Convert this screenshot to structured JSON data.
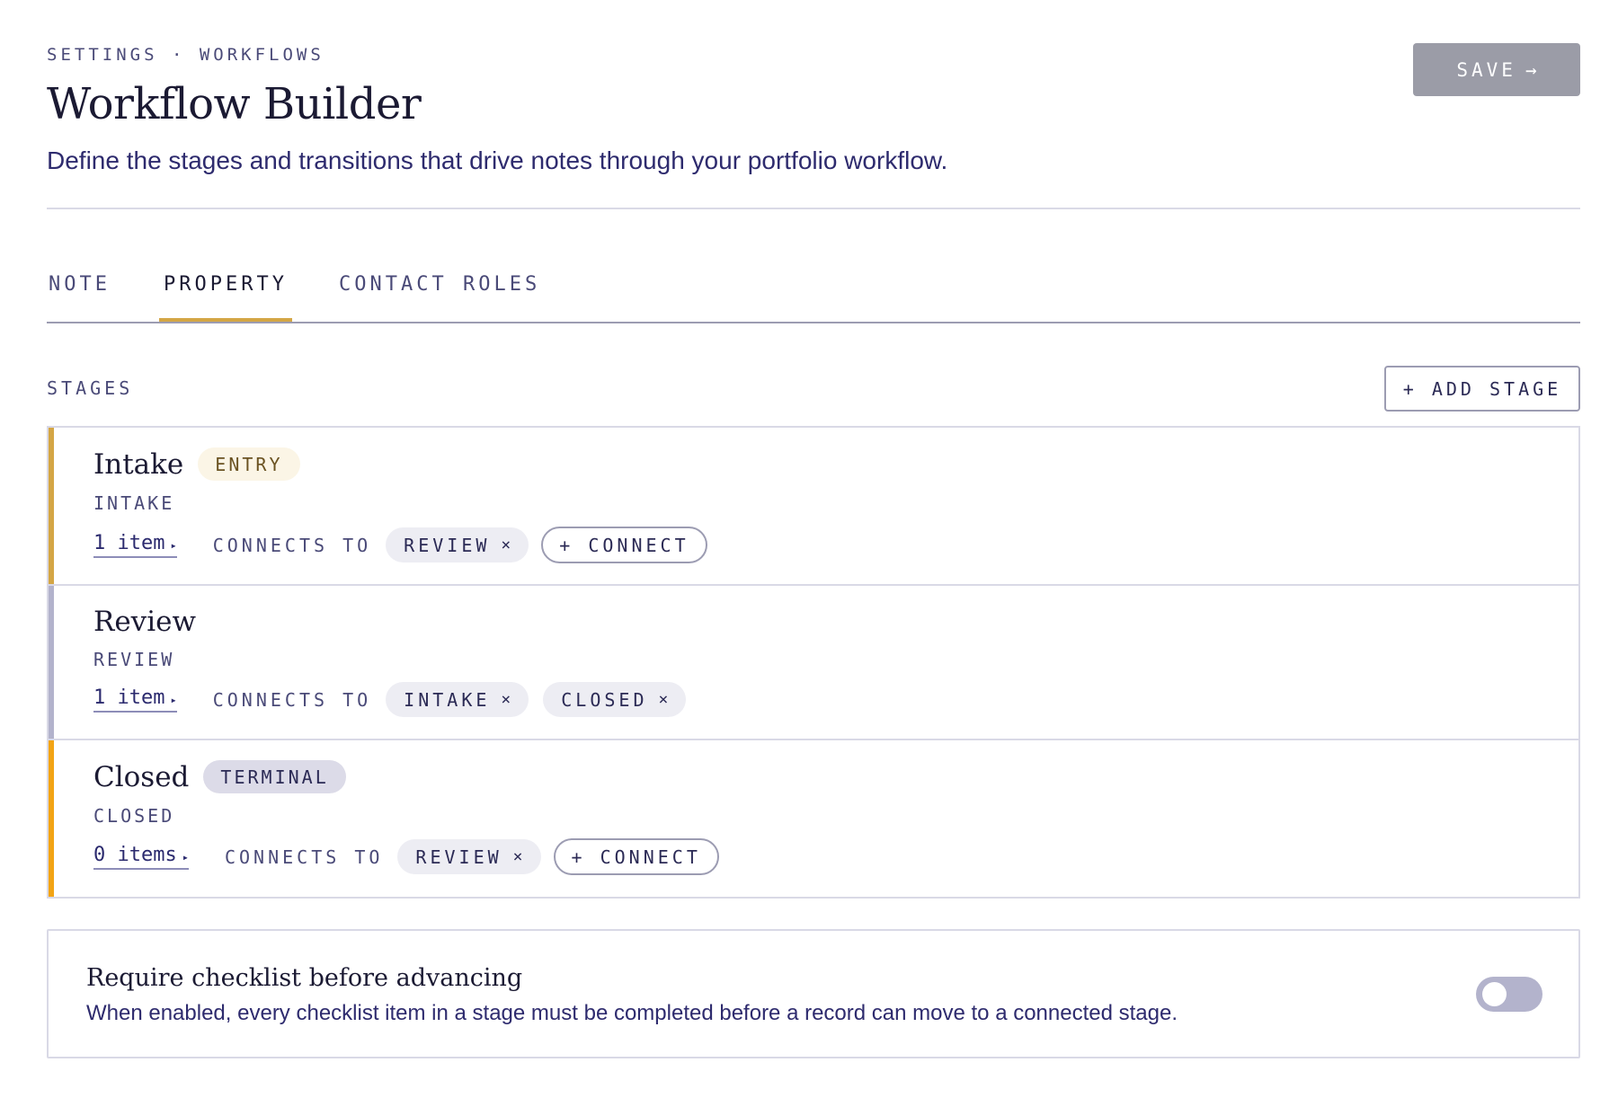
{
  "header": {
    "breadcrumb": "SETTINGS · WORKFLOWS",
    "title": "Workflow Builder",
    "subtitle": "Define the stages and transitions that drive notes through your portfolio workflow.",
    "save_label": "SAVE",
    "save_arrow": "→"
  },
  "tabs": [
    {
      "label": "NOTE",
      "active": false
    },
    {
      "label": "PROPERTY",
      "active": true
    },
    {
      "label": "CONTACT ROLES",
      "active": false
    }
  ],
  "stages_section": {
    "label": "STAGES",
    "add_label": "+ ADD STAGE",
    "connects_label": "CONNECTS TO",
    "connect_button_label": "+ CONNECT",
    "remove_glyph": "×",
    "items_glyph": "▸"
  },
  "stages": [
    {
      "name": "Intake",
      "badge": "ENTRY",
      "key": "INTAKE",
      "items": "1 item",
      "connections": [
        "REVIEW"
      ],
      "accent": "#d4a645"
    },
    {
      "name": "Review",
      "badge": "",
      "key": "REVIEW",
      "items": "1 item",
      "connections": [
        "INTAKE",
        "CLOSED"
      ],
      "accent": "#b3b3cc"
    },
    {
      "name": "Closed",
      "badge": "TERMINAL",
      "key": "CLOSED",
      "items": "0 items",
      "connections": [
        "REVIEW"
      ],
      "accent": "#f2a414"
    }
  ],
  "setting": {
    "title": "Require checklist before advancing",
    "description": "When enabled, every checklist item in a stage must be completed before a record can move to a connected stage.",
    "enabled": false
  },
  "colors": {
    "accent_gold": "#d4a645",
    "text_indigo": "#2e2b6e",
    "save_disabled": "#9b9ca7"
  }
}
